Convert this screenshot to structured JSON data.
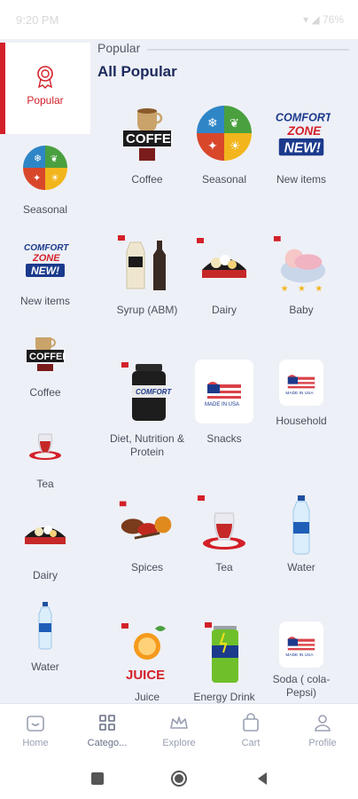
{
  "status": {
    "time": "9:20 PM",
    "right": "▾ ◢ 76%"
  },
  "header": {
    "crumb": "Popular",
    "title": "All Popular"
  },
  "sidebar": {
    "items": [
      {
        "label": "Popular",
        "icon": "badge-icon"
      },
      {
        "label": "Seasonal",
        "icon": "seasonal-icon"
      },
      {
        "label": "New items",
        "icon": "comfort-zone-new-icon"
      },
      {
        "label": "Coffee",
        "icon": "coffee-icon"
      },
      {
        "label": "Tea",
        "icon": "tea-icon"
      },
      {
        "label": "Dairy",
        "icon": "dairy-icon"
      },
      {
        "label": "Water",
        "icon": "water-bottle-icon"
      }
    ]
  },
  "grid": {
    "items": [
      {
        "label": "Coffee",
        "icon": "coffee-icon"
      },
      {
        "label": "Seasonal",
        "icon": "seasonal-icon"
      },
      {
        "label": "New items",
        "icon": "comfort-zone-new-icon"
      },
      {
        "label": "Syrup (ABM)",
        "icon": "syrup-icon"
      },
      {
        "label": "Dairy",
        "icon": "dairy-icon"
      },
      {
        "label": "Baby",
        "icon": "baby-icon"
      },
      {
        "label": "Diet, Nutrition & Protein",
        "icon": "protein-jar-icon"
      },
      {
        "label": "Snacks",
        "icon": "made-in-usa-icon"
      },
      {
        "label": "Household",
        "icon": "made-in-usa-icon"
      },
      {
        "label": "Spices",
        "icon": "spices-icon"
      },
      {
        "label": "Tea",
        "icon": "tea-icon"
      },
      {
        "label": "Water",
        "icon": "water-bottle-icon"
      },
      {
        "label": "Juice",
        "icon": "juice-icon"
      },
      {
        "label": "Energy Drink",
        "icon": "energy-can-icon"
      },
      {
        "label": "Soda ( cola-Pepsi)",
        "icon": "made-in-usa-icon"
      }
    ],
    "card_text": {
      "coffee": "COFFEE",
      "juice": "JUICE",
      "usa": "MADE IN USA",
      "cz1": "COMFORT",
      "cz2": "ZONE",
      "cz3": "NEW!"
    }
  },
  "nav": {
    "items": [
      {
        "label": "Home",
        "icon": "home-icon"
      },
      {
        "label": "Catego...",
        "icon": "categories-icon"
      },
      {
        "label": "Explore",
        "icon": "crown-icon"
      },
      {
        "label": "Cart",
        "icon": "bag-icon"
      },
      {
        "label": "Profile",
        "icon": "person-icon"
      }
    ]
  },
  "colors": {
    "accent": "#d32029",
    "title": "#1c2a5c",
    "background": "#eef0f7"
  }
}
